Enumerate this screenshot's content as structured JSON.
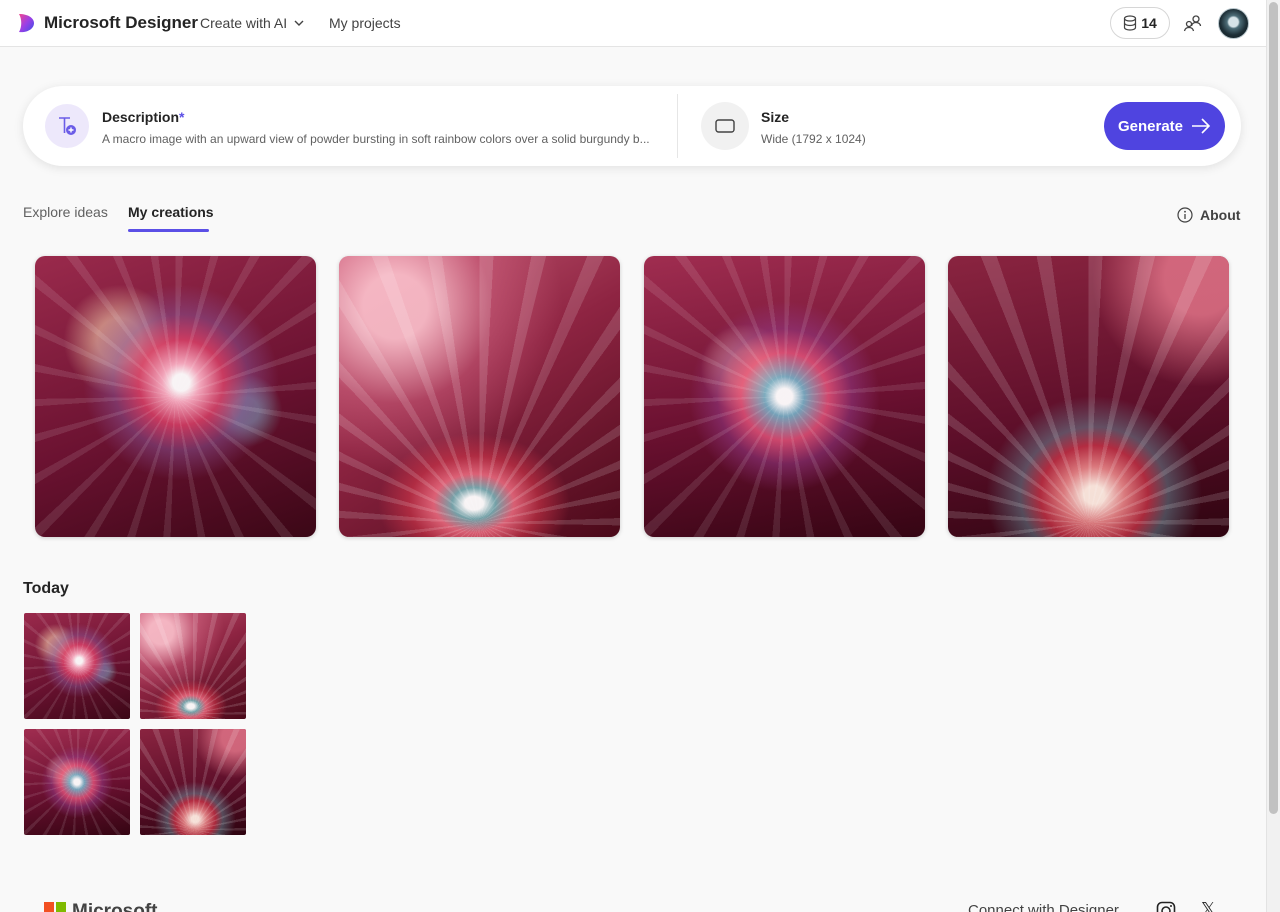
{
  "header": {
    "brand": "Microsoft Designer",
    "nav_create": "Create with AI",
    "nav_projects": "My projects",
    "credits": "14",
    "brand_colors": {
      "logo_gradient": [
        "#e13a9d",
        "#7a3ff0",
        "#3a4fe6"
      ]
    }
  },
  "prompt": {
    "description_label": "Description",
    "required_mark": "*",
    "description_text": "A macro image with an upward view of powder bursting in soft rainbow colors over a solid burgundy b...",
    "size_label": "Size",
    "size_value": "Wide (1792 x 1024)",
    "generate_label": "Generate",
    "accent_color": "#4f44e0"
  },
  "tabs": {
    "explore": "Explore ideas",
    "mine": "My creations",
    "active": "My creations",
    "about": "About"
  },
  "sections": {
    "today": "Today"
  },
  "footer": {
    "ms_word": "Microsoft",
    "connect": "Connect with Designer"
  },
  "icons": {
    "logo": "designer-logo-icon",
    "chevron": "chevron-down-icon",
    "credits": "coin-stack-icon",
    "share": "share-people-icon",
    "description": "text-add-icon",
    "size": "aspect-ratio-icon",
    "generate": "arrow-right-icon",
    "about": "info-icon",
    "instagram": "instagram-icon",
    "x": "x-icon"
  }
}
